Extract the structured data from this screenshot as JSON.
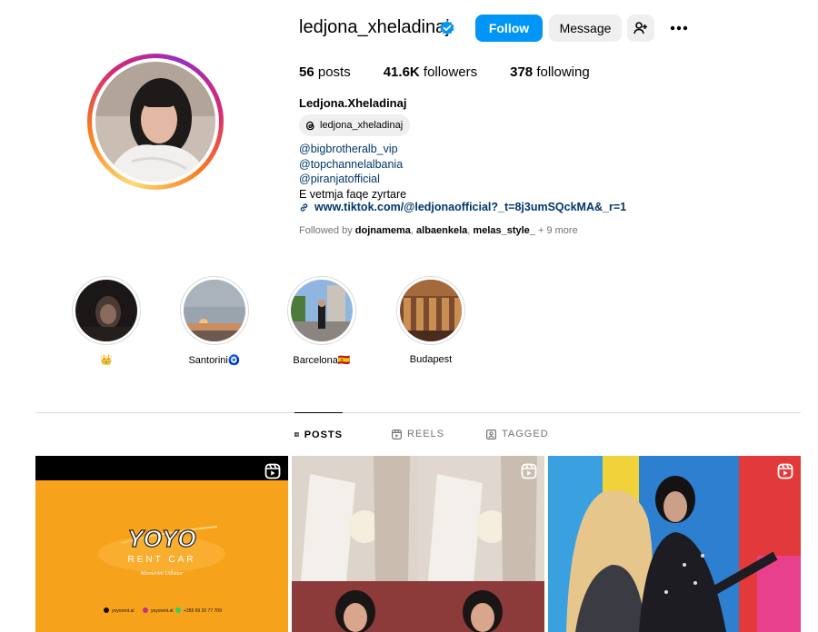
{
  "profile": {
    "username": "ledjona_xheladinaj",
    "verified_icon": "verified-badge-icon",
    "follow_label": "Follow",
    "message_label": "Message",
    "stats": {
      "posts_count": "56",
      "posts_label": "posts",
      "followers_count": "41.6K",
      "followers_label": "followers",
      "following_count": "378",
      "following_label": "following"
    },
    "full_name": "Ledjona.Xheladinaj",
    "threads_handle": "ledjona_xheladinaj",
    "bio": {
      "mention1": "@bigbrotheralb_vip",
      "mention2": "@topchannelalbania",
      "mention3": "@piranjatofficial",
      "text": "E vetmja faqe zyrtare",
      "link": "www.tiktok.com/@ledjonaofficial?_t=8j3umSQckMA&_r=1"
    },
    "followed_by": {
      "prefix": "Followed by",
      "user1": "dojnamema",
      "user2": "albaenkela",
      "user3": "melas_style_",
      "more": "+ 9 more"
    }
  },
  "highlights": [
    {
      "label": "👑"
    },
    {
      "label": "Santorini🧿"
    },
    {
      "label": "Barcelona🇪🇸"
    },
    {
      "label": "Budapest"
    }
  ],
  "tabs": {
    "posts": "POSTS",
    "reels": "REELS",
    "tagged": "TAGGED"
  },
  "posts": {
    "post1": {
      "brand": "YOYO",
      "subtitle": "RENT CAR",
      "tagline": "Miresevini Udhetar",
      "contact1": "yoyorent.al",
      "contact2": "yoyorent.al",
      "contact3": "+355 69 20 77 709"
    }
  },
  "colors": {
    "follow_blue": "#0095f6",
    "link_blue": "#00376b",
    "secondary_gray": "#737373",
    "button_gray": "#efefef",
    "post1_orange": "#f7a21b"
  }
}
